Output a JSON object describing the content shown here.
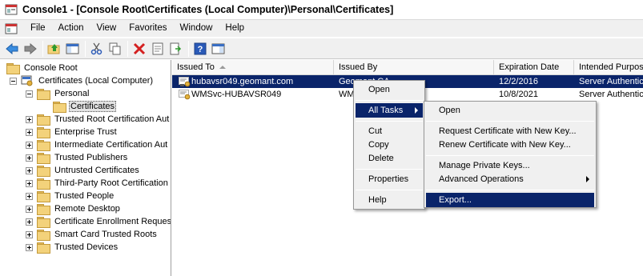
{
  "window": {
    "title": "Console1 - [Console Root\\Certificates (Local Computer)\\Personal\\Certificates]"
  },
  "menubar": {
    "items": [
      "File",
      "Action",
      "View",
      "Favorites",
      "Window",
      "Help"
    ]
  },
  "toolbar": {
    "buttons": [
      "back-icon",
      "forward-icon",
      "up-folder-icon",
      "show-hide-tree-icon",
      "cut-icon",
      "copy-icon",
      "delete-icon",
      "properties-icon",
      "export-list-icon",
      "help-icon",
      "show-action-pane-icon"
    ]
  },
  "tree": {
    "root": "Console Root",
    "certificates": "Certificates (Local Computer)",
    "personal": "Personal",
    "personal_certificates": "Certificates",
    "stores": [
      "Trusted Root Certification Aut",
      "Enterprise Trust",
      "Intermediate Certification Aut",
      "Trusted Publishers",
      "Untrusted Certificates",
      "Third-Party Root Certification",
      "Trusted People",
      "Remote Desktop",
      "Certificate Enrollment Reques",
      "Smart Card Trusted Roots",
      "Trusted Devices"
    ]
  },
  "list": {
    "columns": [
      "Issued To",
      "Issued By",
      "Expiration Date",
      "Intended Purpos"
    ],
    "rows": [
      {
        "issued_to": "hubavsr049.geomant.com",
        "issued_by": "Geomant CA",
        "expiration": "12/2/2016",
        "purpose": "Server Authentic"
      },
      {
        "issued_to": "WMSvc-HUBAVSR049",
        "issued_by": "WM",
        "expiration": "10/8/2021",
        "purpose": "Server Authentic"
      }
    ]
  },
  "context_menu": {
    "open": "Open",
    "all_tasks": "All Tasks",
    "cut": "Cut",
    "copy": "Copy",
    "delete": "Delete",
    "properties": "Properties",
    "help": "Help"
  },
  "submenu": {
    "open": "Open",
    "request_new_key": "Request Certificate with New Key...",
    "renew_new_key": "Renew Certificate with New Key...",
    "manage_keys": "Manage Private Keys...",
    "advanced": "Advanced Operations",
    "export": "Export..."
  },
  "colors": {
    "selection": "#0a246a",
    "menu_bg": "#f0f0f0",
    "folder": "#f3d27b"
  }
}
